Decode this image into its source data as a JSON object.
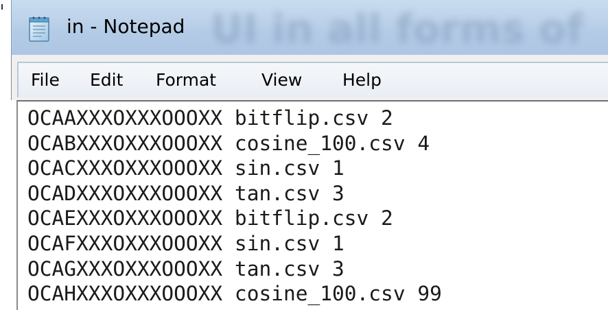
{
  "window": {
    "title": "in - Notepad",
    "app_icon": "notepad-icon"
  },
  "menu": {
    "items": [
      {
        "label": "File"
      },
      {
        "label": "Edit"
      },
      {
        "label": "Format"
      },
      {
        "label": "View"
      },
      {
        "label": "Help"
      }
    ]
  },
  "editor": {
    "lines": [
      "OCAAXXXOXXXOOOXX bitflip.csv 2",
      "OCABXXXOXXXOOOXX cosine_100.csv 4",
      "OCACXXXOXXXOOOXX sin.csv 1",
      "OCADXXXOXXXOOOXX tan.csv 3",
      "OCAEXXXOXXXOOOXX bitflip.csv 2",
      "OCAFXXXOXXXOOOXX sin.csv 1",
      "OCAGXXXOXXXOOOXX tan.csv 3",
      "OCAHXXXOXXXOOOXX cosine_100.csv 99"
    ]
  },
  "colors": {
    "title_bar": "#bed3ea",
    "menu_bar": "#f0f0f0",
    "editor_background": "#ffffff",
    "text": "#1a1a1a"
  }
}
